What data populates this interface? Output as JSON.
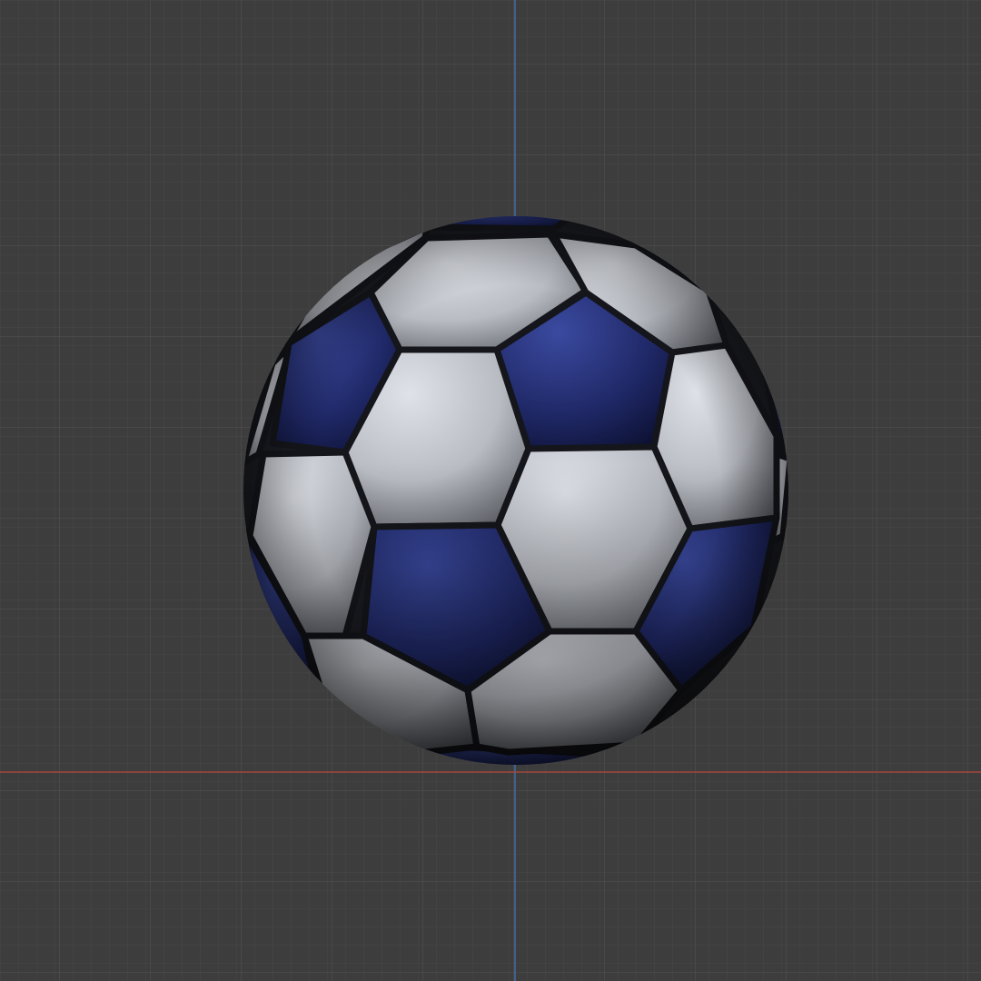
{
  "viewport": {
    "background_color": "#3d3d3d",
    "grid_minor_color": "#474747",
    "grid_major_color": "#525252",
    "axis_y_color": "#3f6ca8",
    "axis_x_color": "#a5473c"
  },
  "model": {
    "object": "soccer-ball",
    "panel_colors": {
      "white": "#c3c6cc",
      "blue": "#2a3578",
      "seam": "#1a1a1f"
    }
  }
}
